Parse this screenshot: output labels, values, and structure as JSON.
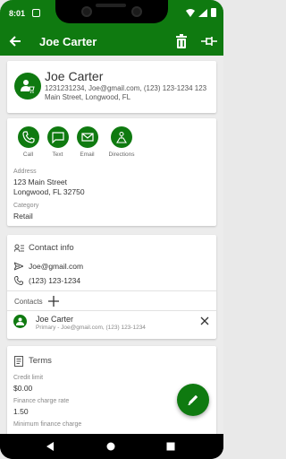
{
  "status_bar": {
    "time": "8:01"
  },
  "app_bar": {
    "title": "Joe Carter"
  },
  "header_card": {
    "name": "Joe Carter",
    "details_line1": "1231231234, Joe@gmail.com, (123) 123-1234 123",
    "details_line2": "Main Street, Longwood, FL"
  },
  "actions": [
    {
      "label": "Call",
      "icon": "phone-icon"
    },
    {
      "label": "Text",
      "icon": "message-icon"
    },
    {
      "label": "Email",
      "icon": "email-icon"
    },
    {
      "label": "Directions",
      "icon": "directions-icon"
    }
  ],
  "address": {
    "label": "Address",
    "line1": "123 Main Street",
    "line2": "Longwood, FL 32750"
  },
  "category": {
    "label": "Category",
    "value": "Retail"
  },
  "contact_info": {
    "title": "Contact info",
    "email": "Joe@gmail.com",
    "phone": "(123) 123-1234"
  },
  "contacts": {
    "title": "Contacts",
    "items": [
      {
        "name": "Joe Carter",
        "detail": "Primary - Joe@gmail.com, (123) 123-1234"
      }
    ]
  },
  "terms": {
    "title": "Terms",
    "credit_limit_label": "Credit limit",
    "credit_limit_value": "$0.00",
    "finance_rate_label": "Finance charge rate",
    "finance_rate_value": "1.50",
    "min_finance_label": "Minimum finance charge"
  },
  "colors": {
    "primary": "#0f7a10"
  }
}
